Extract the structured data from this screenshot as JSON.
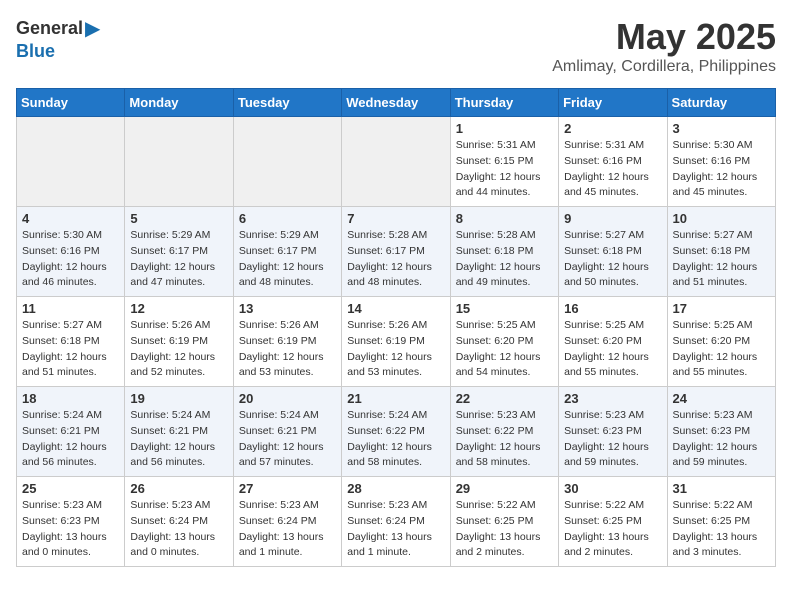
{
  "logo": {
    "general": "General",
    "blue": "Blue"
  },
  "header": {
    "month": "May 2025",
    "location": "Amlimay, Cordillera, Philippines"
  },
  "weekdays": [
    "Sunday",
    "Monday",
    "Tuesday",
    "Wednesday",
    "Thursday",
    "Friday",
    "Saturday"
  ],
  "weeks": [
    [
      {
        "day": "",
        "info": ""
      },
      {
        "day": "",
        "info": ""
      },
      {
        "day": "",
        "info": ""
      },
      {
        "day": "",
        "info": ""
      },
      {
        "day": "1",
        "info": "Sunrise: 5:31 AM\nSunset: 6:15 PM\nDaylight: 12 hours\nand 44 minutes."
      },
      {
        "day": "2",
        "info": "Sunrise: 5:31 AM\nSunset: 6:16 PM\nDaylight: 12 hours\nand 45 minutes."
      },
      {
        "day": "3",
        "info": "Sunrise: 5:30 AM\nSunset: 6:16 PM\nDaylight: 12 hours\nand 45 minutes."
      }
    ],
    [
      {
        "day": "4",
        "info": "Sunrise: 5:30 AM\nSunset: 6:16 PM\nDaylight: 12 hours\nand 46 minutes."
      },
      {
        "day": "5",
        "info": "Sunrise: 5:29 AM\nSunset: 6:17 PM\nDaylight: 12 hours\nand 47 minutes."
      },
      {
        "day": "6",
        "info": "Sunrise: 5:29 AM\nSunset: 6:17 PM\nDaylight: 12 hours\nand 48 minutes."
      },
      {
        "day": "7",
        "info": "Sunrise: 5:28 AM\nSunset: 6:17 PM\nDaylight: 12 hours\nand 48 minutes."
      },
      {
        "day": "8",
        "info": "Sunrise: 5:28 AM\nSunset: 6:18 PM\nDaylight: 12 hours\nand 49 minutes."
      },
      {
        "day": "9",
        "info": "Sunrise: 5:27 AM\nSunset: 6:18 PM\nDaylight: 12 hours\nand 50 minutes."
      },
      {
        "day": "10",
        "info": "Sunrise: 5:27 AM\nSunset: 6:18 PM\nDaylight: 12 hours\nand 51 minutes."
      }
    ],
    [
      {
        "day": "11",
        "info": "Sunrise: 5:27 AM\nSunset: 6:18 PM\nDaylight: 12 hours\nand 51 minutes."
      },
      {
        "day": "12",
        "info": "Sunrise: 5:26 AM\nSunset: 6:19 PM\nDaylight: 12 hours\nand 52 minutes."
      },
      {
        "day": "13",
        "info": "Sunrise: 5:26 AM\nSunset: 6:19 PM\nDaylight: 12 hours\nand 53 minutes."
      },
      {
        "day": "14",
        "info": "Sunrise: 5:26 AM\nSunset: 6:19 PM\nDaylight: 12 hours\nand 53 minutes."
      },
      {
        "day": "15",
        "info": "Sunrise: 5:25 AM\nSunset: 6:20 PM\nDaylight: 12 hours\nand 54 minutes."
      },
      {
        "day": "16",
        "info": "Sunrise: 5:25 AM\nSunset: 6:20 PM\nDaylight: 12 hours\nand 55 minutes."
      },
      {
        "day": "17",
        "info": "Sunrise: 5:25 AM\nSunset: 6:20 PM\nDaylight: 12 hours\nand 55 minutes."
      }
    ],
    [
      {
        "day": "18",
        "info": "Sunrise: 5:24 AM\nSunset: 6:21 PM\nDaylight: 12 hours\nand 56 minutes."
      },
      {
        "day": "19",
        "info": "Sunrise: 5:24 AM\nSunset: 6:21 PM\nDaylight: 12 hours\nand 56 minutes."
      },
      {
        "day": "20",
        "info": "Sunrise: 5:24 AM\nSunset: 6:21 PM\nDaylight: 12 hours\nand 57 minutes."
      },
      {
        "day": "21",
        "info": "Sunrise: 5:24 AM\nSunset: 6:22 PM\nDaylight: 12 hours\nand 58 minutes."
      },
      {
        "day": "22",
        "info": "Sunrise: 5:23 AM\nSunset: 6:22 PM\nDaylight: 12 hours\nand 58 minutes."
      },
      {
        "day": "23",
        "info": "Sunrise: 5:23 AM\nSunset: 6:23 PM\nDaylight: 12 hours\nand 59 minutes."
      },
      {
        "day": "24",
        "info": "Sunrise: 5:23 AM\nSunset: 6:23 PM\nDaylight: 12 hours\nand 59 minutes."
      }
    ],
    [
      {
        "day": "25",
        "info": "Sunrise: 5:23 AM\nSunset: 6:23 PM\nDaylight: 13 hours\nand 0 minutes."
      },
      {
        "day": "26",
        "info": "Sunrise: 5:23 AM\nSunset: 6:24 PM\nDaylight: 13 hours\nand 0 minutes."
      },
      {
        "day": "27",
        "info": "Sunrise: 5:23 AM\nSunset: 6:24 PM\nDaylight: 13 hours\nand 1 minute."
      },
      {
        "day": "28",
        "info": "Sunrise: 5:23 AM\nSunset: 6:24 PM\nDaylight: 13 hours\nand 1 minute."
      },
      {
        "day": "29",
        "info": "Sunrise: 5:22 AM\nSunset: 6:25 PM\nDaylight: 13 hours\nand 2 minutes."
      },
      {
        "day": "30",
        "info": "Sunrise: 5:22 AM\nSunset: 6:25 PM\nDaylight: 13 hours\nand 2 minutes."
      },
      {
        "day": "31",
        "info": "Sunrise: 5:22 AM\nSunset: 6:25 PM\nDaylight: 13 hours\nand 3 minutes."
      }
    ]
  ]
}
